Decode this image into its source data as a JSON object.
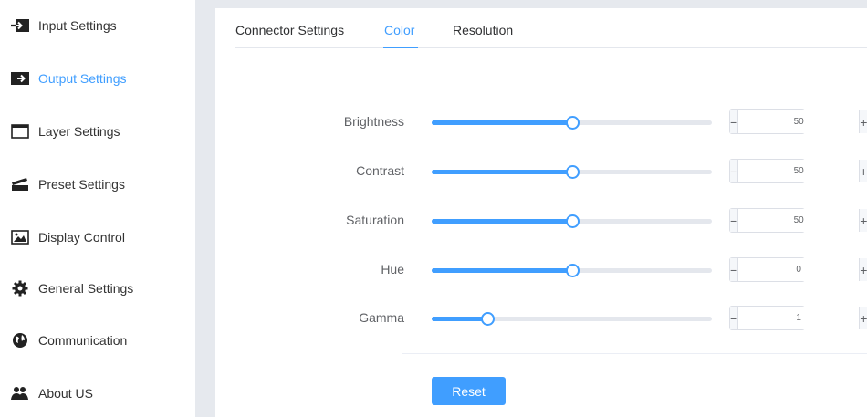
{
  "sidebar": {
    "items": [
      {
        "label": "Input Settings",
        "icon": "input-icon",
        "active": false
      },
      {
        "label": "Output Settings",
        "icon": "output-icon",
        "active": true
      },
      {
        "label": "Layer Settings",
        "icon": "layer-icon",
        "active": false
      },
      {
        "label": "Preset Settings",
        "icon": "preset-icon",
        "active": false
      },
      {
        "label": "Display Control",
        "icon": "image-icon",
        "active": false
      },
      {
        "label": "General Settings",
        "icon": "gear-icon",
        "active": false
      },
      {
        "label": "Communication",
        "icon": "globe-icon",
        "active": false
      },
      {
        "label": "About US",
        "icon": "users-icon",
        "active": false
      }
    ]
  },
  "tabs": [
    {
      "label": "Connector Settings",
      "active": false
    },
    {
      "label": "Color",
      "active": true
    },
    {
      "label": "Resolution",
      "active": false
    }
  ],
  "controls": [
    {
      "label": "Brightness",
      "value": "50",
      "fill_fraction": 0.5
    },
    {
      "label": "Contrast",
      "value": "50",
      "fill_fraction": 0.5
    },
    {
      "label": "Saturation",
      "value": "50",
      "fill_fraction": 0.5
    },
    {
      "label": "Hue",
      "value": "0",
      "fill_fraction": 0.5
    },
    {
      "label": "Gamma",
      "value": "1",
      "fill_fraction": 0.2
    }
  ],
  "stepper": {
    "minus": "−",
    "plus": "+"
  },
  "reset_label": "Reset",
  "colors": {
    "accent": "#409eff",
    "background_gray": "#e6e9ee"
  }
}
